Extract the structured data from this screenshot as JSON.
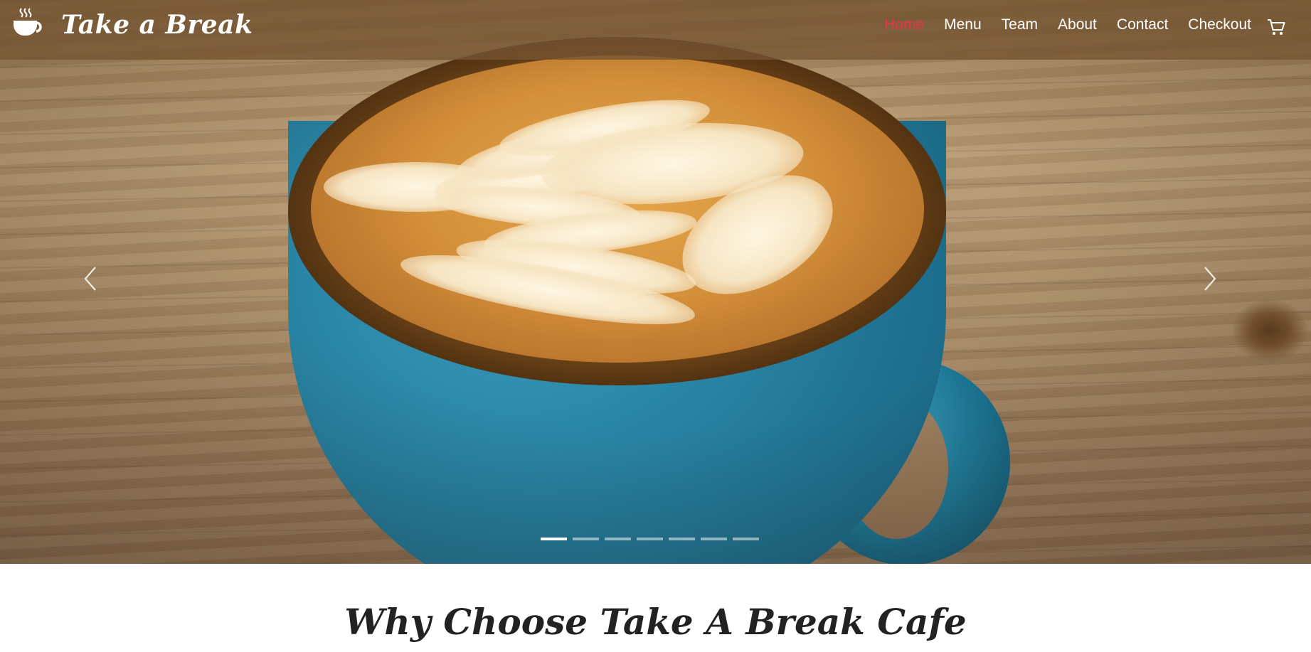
{
  "brand": {
    "name": "Take a Break",
    "icon": "coffee-cup-icon"
  },
  "nav": {
    "items": [
      {
        "label": "Home",
        "active": true
      },
      {
        "label": "Menu",
        "active": false
      },
      {
        "label": "Team",
        "active": false
      },
      {
        "label": "About",
        "active": false
      },
      {
        "label": "Contact",
        "active": false
      },
      {
        "label": "Checkout",
        "active": false
      }
    ],
    "cart_icon": "shopping-cart-icon",
    "active_color": "#e8344a"
  },
  "carousel": {
    "prev_icon": "chevron-left-icon",
    "next_icon": "chevron-right-icon",
    "slide_count": 7,
    "active_index": 0
  },
  "section": {
    "heading_pre": "Why Choose ",
    "heading_strong": "Take A Break",
    "heading_post": " Cafe"
  }
}
